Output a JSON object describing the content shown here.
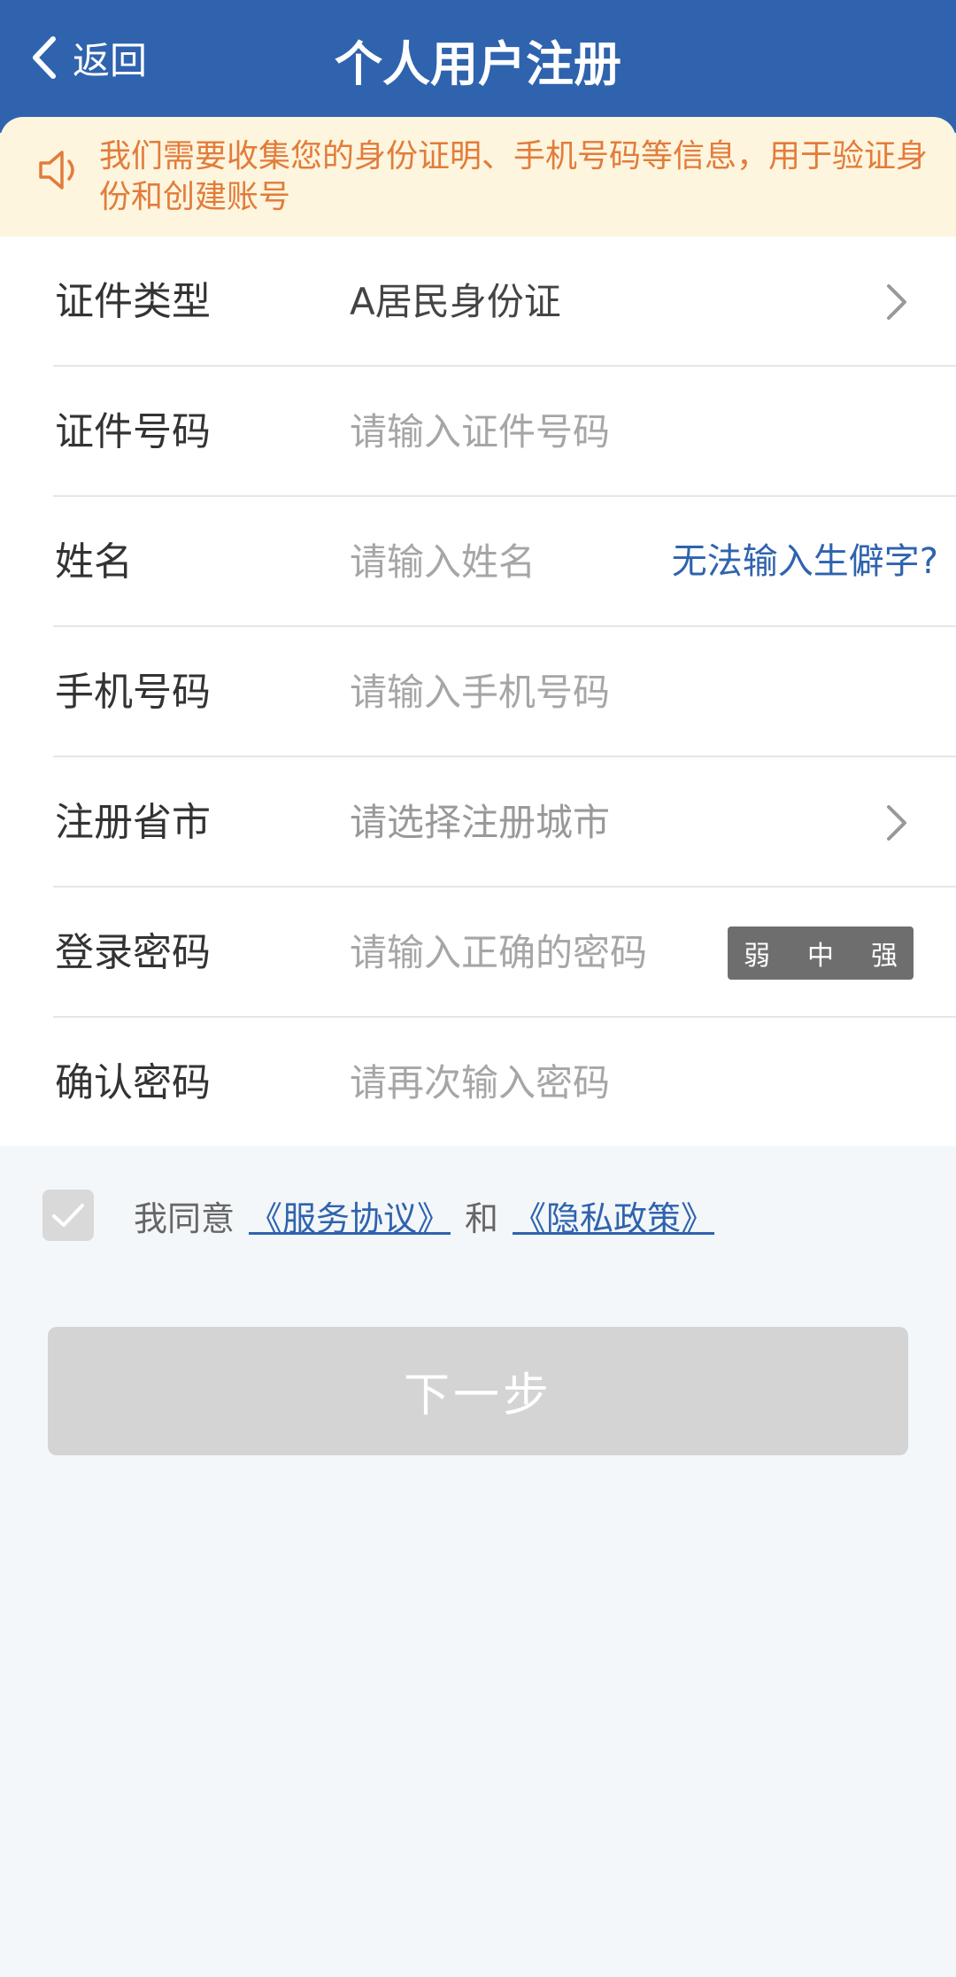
{
  "header": {
    "back_label": "返回",
    "title": "个人用户注册"
  },
  "notice": {
    "text": "我们需要收集您的身份证明、手机号码等信息，用于验证身份和创建账号"
  },
  "form": {
    "id_type": {
      "label": "证件类型",
      "value": "A居民身份证"
    },
    "id_number": {
      "label": "证件号码",
      "placeholder": "请输入证件号码"
    },
    "name": {
      "label": "姓名",
      "placeholder": "请输入姓名",
      "rare_char_link": "无法输入生僻字?"
    },
    "phone": {
      "label": "手机号码",
      "placeholder": "请输入手机号码"
    },
    "region": {
      "label": "注册省市",
      "placeholder": "请选择注册城市"
    },
    "password": {
      "label": "登录密码",
      "placeholder": "请输入正确的密码",
      "strength": {
        "weak": "弱",
        "medium": "中",
        "strong": "强"
      }
    },
    "confirm_password": {
      "label": "确认密码",
      "placeholder": "请再次输入密码"
    }
  },
  "agreement": {
    "prefix": "我同意",
    "service_link": "《服务协议》",
    "and": "和",
    "privacy_link": "《隐私政策》"
  },
  "next_button": "下一步",
  "colors": {
    "header_blue": "#2f63ae",
    "notice_bg": "#fdf5de",
    "notice_text": "#e27c3b",
    "button_disabled": "#d4d4d4"
  }
}
